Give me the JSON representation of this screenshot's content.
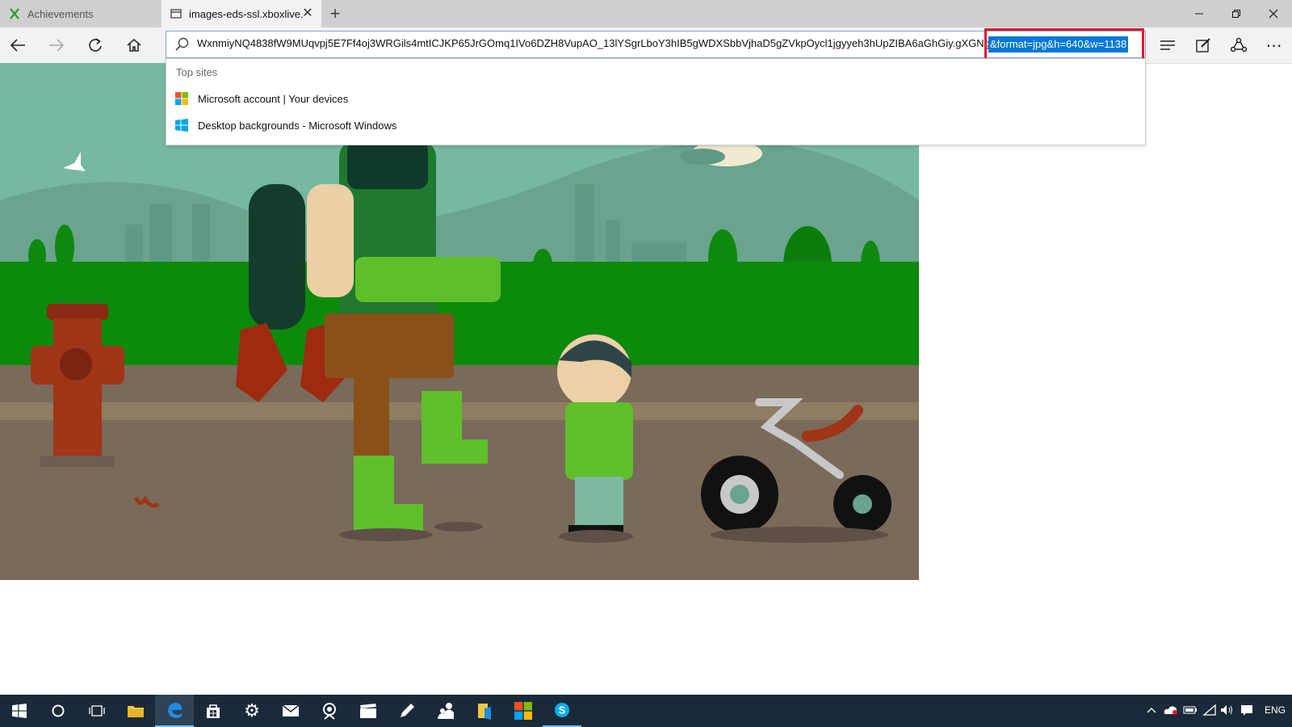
{
  "tabs": [
    {
      "label": "Achievements"
    },
    {
      "label": "images-eds-ssl.xboxlive."
    }
  ],
  "addressbar": {
    "url_visible": "WxnmiyNQ4838fW9MUqvpj5E7Ff4oj3WRGils4mtICJKP65JrGOmq1IVo6DZH8VupAO_13lYSgrLboY3hIB5gWDXSbbVjhaD5gZVkpOycl1jgyyeh3hUpZIBA6aGhGiy.gXGNgEQH",
    "url_selected": "&format=jpg&h=640&w=1138"
  },
  "dropdown": {
    "section_label": "Top sites",
    "sites": [
      {
        "label": "Microsoft account | Your devices",
        "icon": "microsoft-logo-icon"
      },
      {
        "label": "Desktop backgrounds - Microsoft Windows",
        "icon": "windows-logo-icon"
      }
    ]
  },
  "tray": {
    "language": "ENG"
  },
  "colors": {
    "selection": "#0078d7",
    "highlight": "#e0182a",
    "taskbar": "#1a2a3a",
    "sky": "#76b8a0",
    "grass": "#0c8a0c",
    "ground": "#7a6a5a"
  }
}
